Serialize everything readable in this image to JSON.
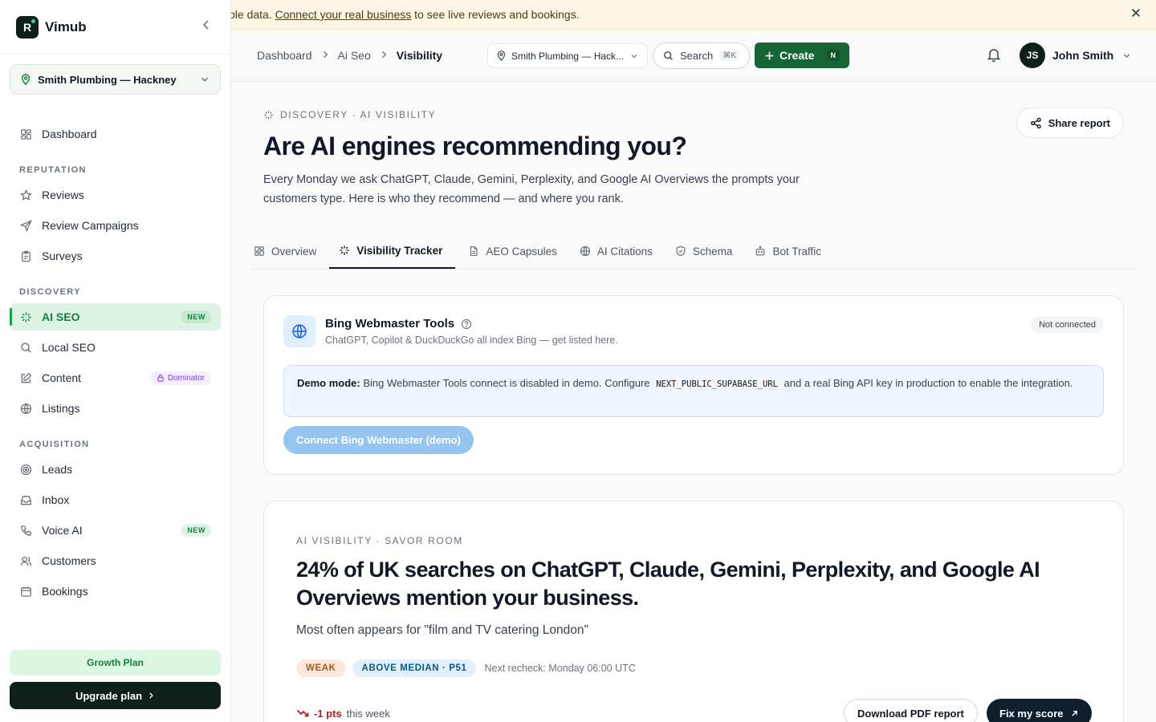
{
  "brand": {
    "name": "Vimub",
    "logo_letter": "R"
  },
  "sidebar": {
    "location": "Smith Plumbing — Hackney",
    "top_item": {
      "label": "Dashboard",
      "icon": "dashboard-grid-icon"
    },
    "sections": [
      {
        "title": "REPUTATION",
        "items": [
          {
            "label": "Reviews",
            "icon": "star-icon"
          },
          {
            "label": "Review Campaigns",
            "icon": "send-icon"
          },
          {
            "label": "Surveys",
            "icon": "clipboard-icon"
          }
        ]
      },
      {
        "title": "DISCOVERY",
        "items": [
          {
            "label": "AI SEO",
            "icon": "sparkle-icon",
            "badge": "NEW",
            "active": true
          },
          {
            "label": "Local SEO",
            "icon": "search-icon"
          },
          {
            "label": "Content",
            "icon": "edit-icon",
            "badge": "Dominator"
          },
          {
            "label": "Listings",
            "icon": "globe-icon"
          }
        ]
      },
      {
        "title": "ACQUISITION",
        "items": [
          {
            "label": "Leads",
            "icon": "target-icon"
          },
          {
            "label": "Inbox",
            "icon": "inbox-icon"
          },
          {
            "label": "Voice AI",
            "icon": "phone-icon",
            "badge": "NEW"
          },
          {
            "label": "Customers",
            "icon": "users-icon"
          },
          {
            "label": "Bookings",
            "icon": "calendar-icon"
          }
        ]
      }
    ],
    "plan_label": "Growth Plan",
    "upgrade_label": "Upgrade plan"
  },
  "banner": {
    "text_before": "ple data. ",
    "link": "Connect your real business",
    "text_after": " to see live reviews and bookings."
  },
  "topbar": {
    "breadcrumbs": [
      "Dashboard",
      "Ai Seo",
      "Visibility"
    ],
    "location": "Smith Plumbing — Hack...",
    "search_placeholder": "Search",
    "search_shortcut": "⌘K",
    "create_label": "Create",
    "create_shortcut": "N",
    "user": {
      "initials": "JS",
      "name": "John Smith"
    }
  },
  "page": {
    "eyebrow": "DISCOVERY · AI VISIBILITY",
    "title": "Are AI engines recommending you?",
    "description": "Every Monday we ask ChatGPT, Claude, Gemini, Perplexity, and Google AI Overviews the prompts your customers type. Here is who they recommend — and where you rank.",
    "share_label": "Share report",
    "tabs": [
      {
        "label": "Overview",
        "icon": "grid-icon"
      },
      {
        "label": "Visibility Tracker",
        "icon": "sparkle-icon",
        "active": true
      },
      {
        "label": "AEO Capsules",
        "icon": "file-icon"
      },
      {
        "label": "AI Citations",
        "icon": "globe-icon"
      },
      {
        "label": "Schema",
        "icon": "shield-icon"
      },
      {
        "label": "Bot Traffic",
        "icon": "bot-icon"
      }
    ]
  },
  "bing": {
    "title": "Bing Webmaster Tools",
    "subtitle": "ChatGPT, Copilot & DuckDuckGo all index Bing — get listed here.",
    "status": "Not connected",
    "demo_label": "Demo mode:",
    "demo_text_1": " Bing Webmaster Tools connect is disabled in demo. Configure ",
    "demo_code": "NEXT_PUBLIC_SUPABASE_URL",
    "demo_text_2": " and a real Bing API key in production to enable the integration.",
    "connect_label": "Connect Bing Webmaster (demo)"
  },
  "visibility": {
    "eyebrow": "AI VISIBILITY · SAVOR ROOM",
    "headline": "24% of UK searches on ChatGPT, Claude, Gemini, Perplexity, and Google AI Overviews mention your business.",
    "subline": "Most often appears for \"film and TV catering London\"",
    "pill_weak": "WEAK",
    "pill_median": "ABOVE MEDIAN · P51",
    "recheck": "Next recheck: Monday 06:00 UTC",
    "trend_delta": "-1 pts",
    "trend_suffix": "this week",
    "download_label": "Download PDF report",
    "fix_label": "Fix my score"
  },
  "colors": {
    "accent_green": "#15803d",
    "create_green": "#166534",
    "dark": "#0f1f1a",
    "banner_bg": "#fdf6e4"
  }
}
